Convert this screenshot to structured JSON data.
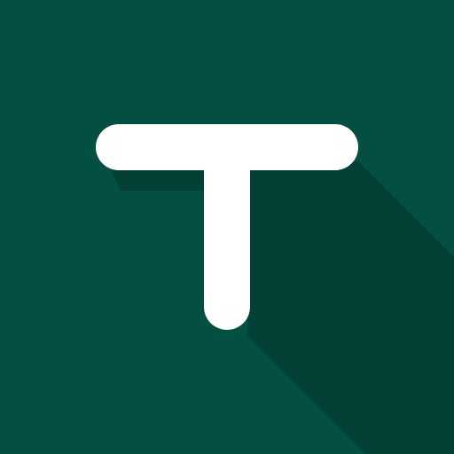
{
  "icon": {
    "name": "letter-t-icon",
    "letter": "T",
    "colors": {
      "background": "#035043",
      "long_shadow": "#023F35",
      "glyph": "#FFFFFF"
    }
  }
}
